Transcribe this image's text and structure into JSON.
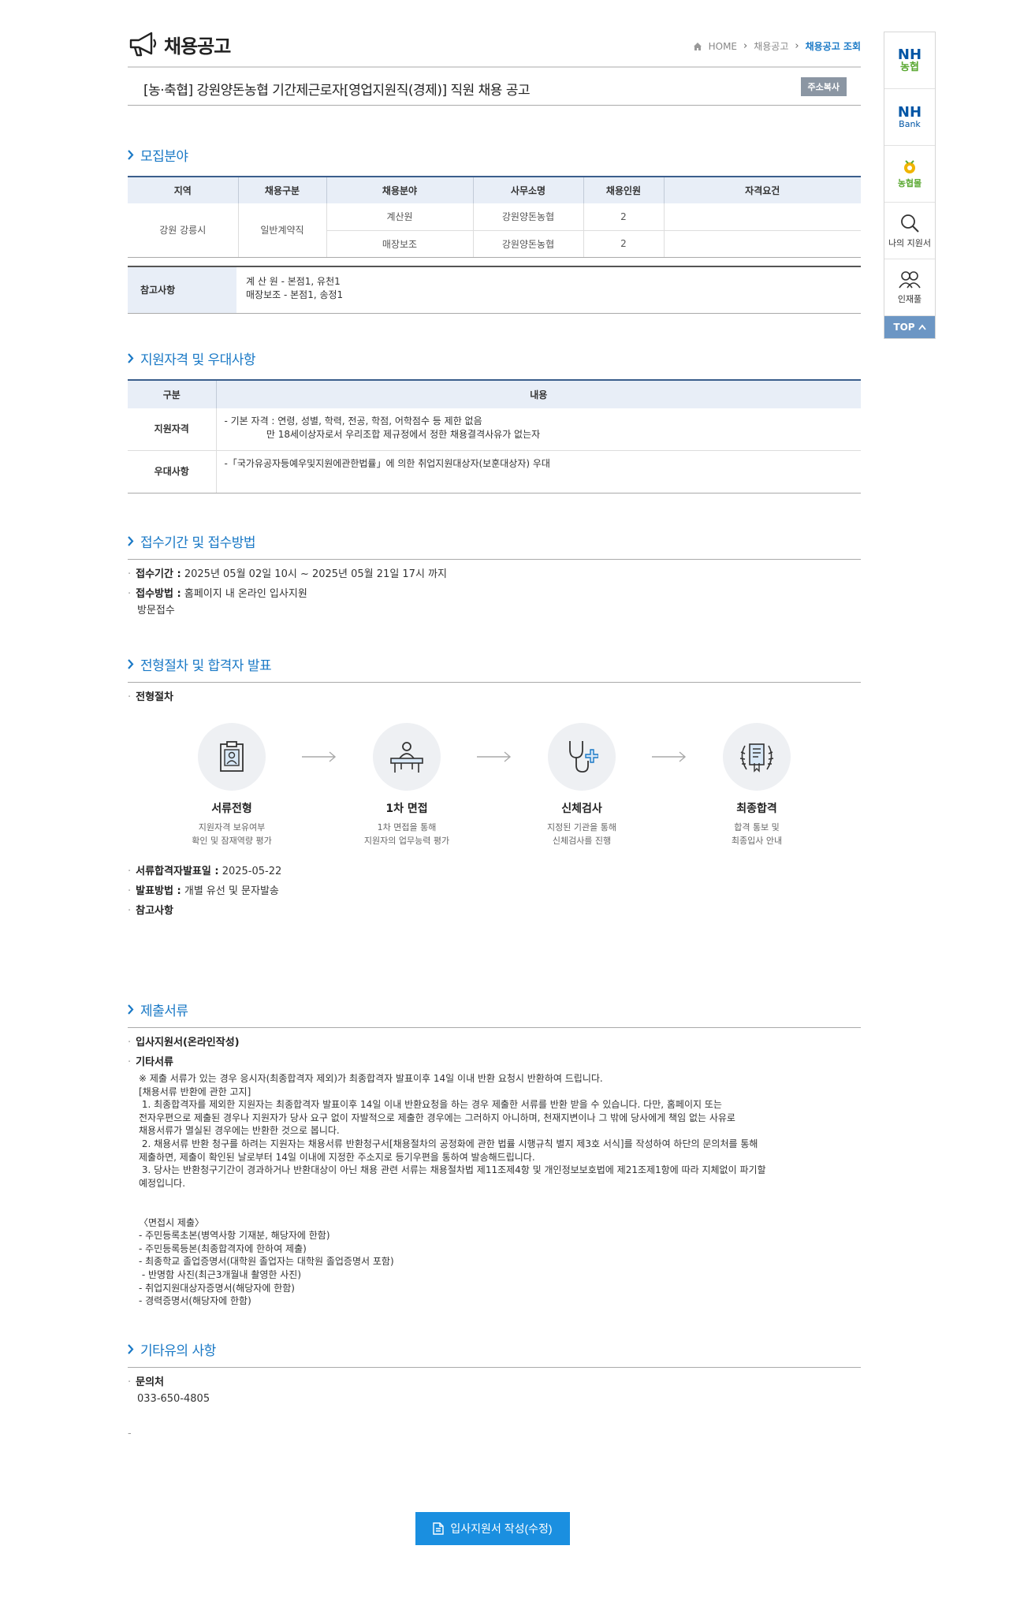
{
  "header": {
    "title": "채용공고",
    "breadcrumb": [
      "HOME",
      "채용공고",
      "채용공고 조회"
    ]
  },
  "post": {
    "title": "[농·축협] 강원양돈농협 기간제근로자[영업지원직(경제)] 직원 채용 공고",
    "copy_label": "주소복사"
  },
  "recruit": {
    "heading": "모집분야",
    "columns": [
      "지역",
      "채용구분",
      "채용분야",
      "사무소명",
      "채용인원",
      "자격요건"
    ],
    "region": "강원 강릉시",
    "type": "일반계약직",
    "rows": [
      {
        "field": "계산원",
        "office": "강원양돈농협",
        "count": "2",
        "req": ""
      },
      {
        "field": "매장보조",
        "office": "강원양돈농협",
        "count": "2",
        "req": ""
      }
    ],
    "note_label": "참고사항",
    "note_lines": [
      "계 산 원 - 본점1, 유천1",
      "매장보조 - 본점1, 송정1"
    ]
  },
  "qualification": {
    "heading": "지원자격 및 우대사항",
    "col_type": "구분",
    "col_content": "내용",
    "rows": [
      {
        "label": "지원자격",
        "lines": [
          "- 기본 자격 : 연령, 성별, 학력, 전공, 학점, 어학점수 등 제한 없음",
          "              만 18세이상자로서 우리조합 제규정에서 정한 채용결격사유가 없는자"
        ]
      },
      {
        "label": "우대사항",
        "lines": [
          "-「국가유공자등예우및지원에관한법률」에 의한 취업지원대상자(보훈대상자) 우대"
        ]
      }
    ]
  },
  "period": {
    "heading": "접수기간 및 접수방법",
    "period_label": "접수기간 :",
    "period_value": "2025년 05월 02일 10시 ~ 2025년 05월 21일 17시 까지",
    "method_label": "접수방법 :",
    "method_value": "홈페이지 내 온라인 입사지원",
    "method_value2": "방문접수"
  },
  "process": {
    "heading": "전형절차 및 합격자 발표",
    "sub_label": "전형절차",
    "steps": [
      {
        "name": "서류전형",
        "desc1": "지원자격 보유여부",
        "desc2": "확인 및 잠재역량 평가"
      },
      {
        "name": "1차 면접",
        "desc1": "1차 면접을 통해",
        "desc2": "지원자의 업무능력 평가"
      },
      {
        "name": "신체검사",
        "desc1": "지정된 기관을 통해",
        "desc2": "신체검사를 진행"
      },
      {
        "name": "최종합격",
        "desc1": "합격 통보 및",
        "desc2": "최종입사 안내"
      }
    ],
    "announce_label": "서류합격자발표일 :",
    "announce_value": "2025-05-22",
    "announce_method_label": "발표방법 :",
    "announce_method_value": "개별 유선 및 문자발송",
    "note_label": "참고사항"
  },
  "documents": {
    "heading": "제출서류",
    "item1": "입사지원서(온라인작성)",
    "item2": "기타서류",
    "text": "※ 제출 서류가 있는 경우 응시자(최종합격자 제외)가 최종합격자 발표이후 14일 이내 반환 요청시 반환하여 드립니다.\n[채용서류 반환에 관한 고지]\n 1. 최종합격자를 제외한 지원자는 최종합격자 발표이후 14일 이내 반환요청을 하는 경우 제출한 서류를 반환 받을 수 있습니다. 다만, 홈페이지 또는\n전자우편으로 제출된 경우나 지원자가 당사 요구 없이 자발적으로 제출한 경우에는 그러하지 아니하며, 천재지변이나 그 밖에 당사에게 책임 없는 사유로\n채용서류가 멸실된 경우에는 반환한 것으로 봅니다.\n 2. 채용서류 반환 청구를 하려는 지원자는 채용서류 반환청구서[채용절차의 공정화에 관한 법률 시행규칙 별지 제3호 서식]를 작성하여 하단의 문의처를 통해\n제출하면, 제출이 확인된 날로부터 14일 이내에 지정한 주소지로 등기우편을 통하여 발송해드립니다.\n 3. 당사는 반환청구기간이 경과하거나 반환대상이 아닌 채용 관련 서류는 채용절차법 제11조제4항 및 개인정보보호법에 제21조제1항에 따라 지체없이 파기할\n예정입니다.\n\n\n〈면접시 제출〉\n- 주민등록초본(병역사항 기재분, 해당자에 한함)\n- 주민등록등본(최종합격자에 한하여 제출)\n- 최종학교 졸업증명서(대학원 졸업자는 대학원 졸업증명서 포함)\n - 반명함 사진(최근3개월내 촬영한 사진)\n- 취업지원대상자증명서(해당자에 한함)\n- 경력증명서(해당자에 한함)"
  },
  "etc": {
    "heading": "기타유의 사항",
    "contact_label": "문의처",
    "contact_value": "033-650-4805",
    "trailing": "-"
  },
  "submit_label": "입사지원서 작성(수정)",
  "quick_menu": {
    "nh_line1": "NH",
    "nh_line2": "농협",
    "bank_line1": "NH",
    "bank_line2": "Bank",
    "mall": "농협몰",
    "my_apply": "나의 지원서",
    "talent": "인재풀",
    "top": "TOP"
  },
  "colors": {
    "accent": "#1a79c6",
    "button": "#1a8fe0",
    "nh_blue": "#0055a5",
    "nh_green": "#5aa832"
  }
}
